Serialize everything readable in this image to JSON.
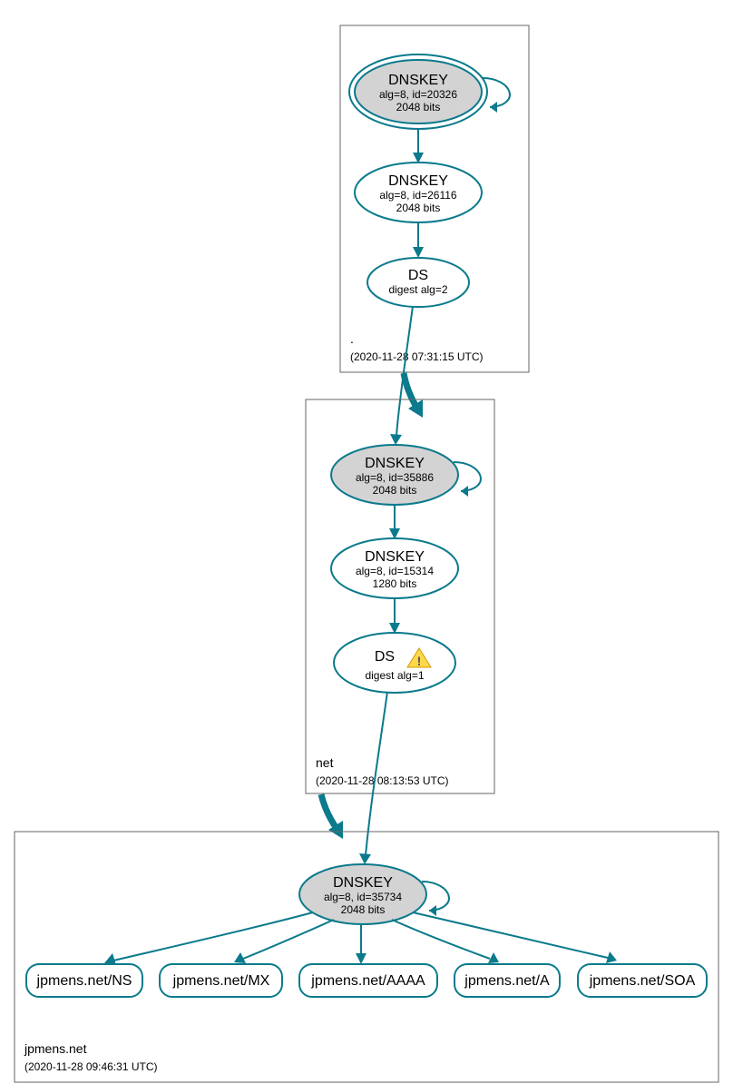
{
  "zones": {
    "root": {
      "label": ".",
      "timestamp": "(2020-11-28 07:31:15 UTC)"
    },
    "net": {
      "label": "net",
      "timestamp": "(2020-11-28 08:13:53 UTC)"
    },
    "jpmens": {
      "label": "jpmens.net",
      "timestamp": "(2020-11-28 09:46:31 UTC)"
    }
  },
  "nodes": {
    "root_ksk": {
      "title": "DNSKEY",
      "sub1": "alg=8, id=20326",
      "sub2": "2048 bits"
    },
    "root_zsk": {
      "title": "DNSKEY",
      "sub1": "alg=8, id=26116",
      "sub2": "2048 bits"
    },
    "root_ds": {
      "title": "DS",
      "sub1": "digest alg=2"
    },
    "net_ksk": {
      "title": "DNSKEY",
      "sub1": "alg=8, id=35886",
      "sub2": "2048 bits"
    },
    "net_zsk": {
      "title": "DNSKEY",
      "sub1": "alg=8, id=15314",
      "sub2": "1280 bits"
    },
    "net_ds": {
      "title": "DS",
      "sub1": "digest alg=1",
      "warn": "⚠"
    },
    "jp_ksk": {
      "title": "DNSKEY",
      "sub1": "alg=8, id=35734",
      "sub2": "2048 bits"
    },
    "rec_ns": {
      "label": "jpmens.net/NS"
    },
    "rec_mx": {
      "label": "jpmens.net/MX"
    },
    "rec_aaaa": {
      "label": "jpmens.net/AAAA"
    },
    "rec_a": {
      "label": "jpmens.net/A"
    },
    "rec_soa": {
      "label": "jpmens.net/SOA"
    }
  }
}
